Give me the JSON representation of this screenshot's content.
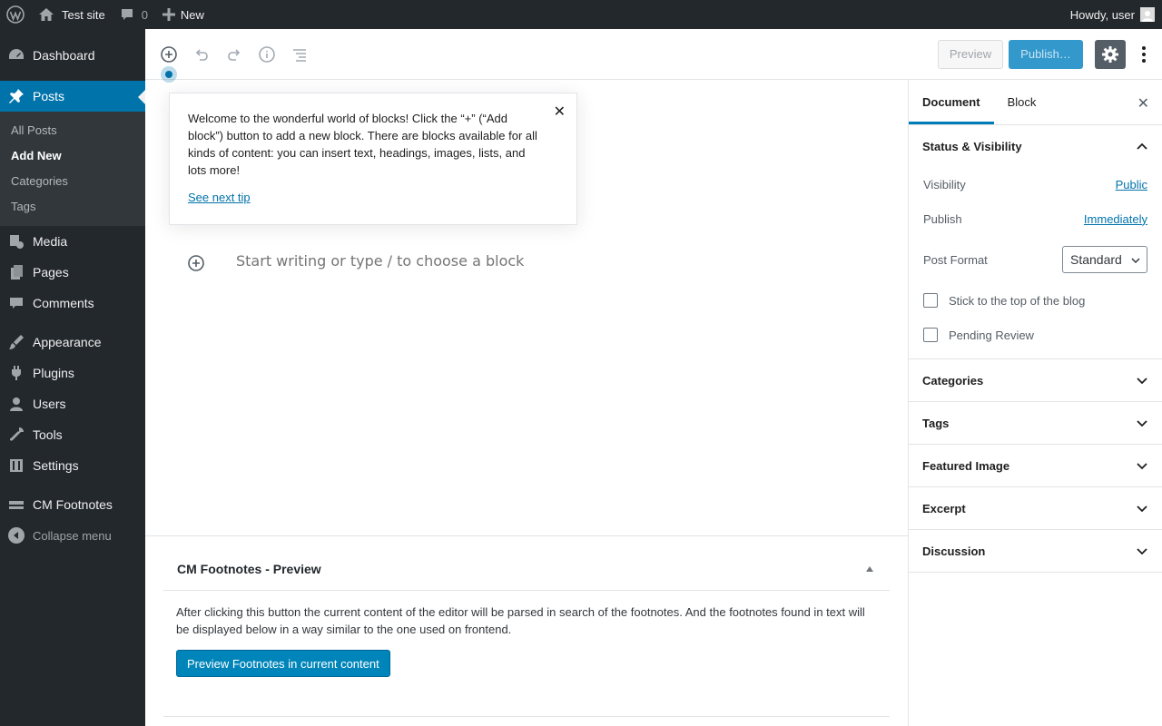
{
  "adminbar": {
    "site_name": "Test site",
    "comment_count": "0",
    "new_label": "New",
    "howdy": "Howdy, user"
  },
  "menu": {
    "dashboard": "Dashboard",
    "posts": "Posts",
    "posts_sub": [
      "All Posts",
      "Add New",
      "Categories",
      "Tags"
    ],
    "media": "Media",
    "pages": "Pages",
    "comments": "Comments",
    "appearance": "Appearance",
    "plugins": "Plugins",
    "users": "Users",
    "tools": "Tools",
    "settings": "Settings",
    "cm_footnotes": "CM Footnotes",
    "collapse": "Collapse menu"
  },
  "header": {
    "preview": "Preview",
    "publish": "Publish…"
  },
  "tip": {
    "text": "Welcome to the wonderful world of blocks! Click the “+” (“Add block”) button to add a new block. There are blocks available for all kinds of content: you can insert text, headings, images, lists, and lots more!",
    "next": "See next tip",
    "close": "✕"
  },
  "editor": {
    "placeholder": "Start writing or type / to choose a block"
  },
  "metabox": {
    "title": "CM Footnotes - Preview",
    "description": "After clicking this button the current content of the editor will be parsed in search of the footnotes. And the footnotes found in text will be displayed below in a way similar to the one used on frontend.",
    "button": "Preview Footnotes in current content"
  },
  "sidebar": {
    "tabs": [
      "Document",
      "Block"
    ],
    "close": "✕",
    "status": {
      "title": "Status & Visibility",
      "visibility_label": "Visibility",
      "visibility_value": "Public",
      "publish_label": "Publish",
      "publish_value": "Immediately",
      "format_label": "Post Format",
      "format_value": "Standard",
      "sticky_label": "Stick to the top of the blog",
      "pending_label": "Pending Review"
    },
    "panels": [
      "Categories",
      "Tags",
      "Featured Image",
      "Excerpt",
      "Discussion"
    ]
  }
}
